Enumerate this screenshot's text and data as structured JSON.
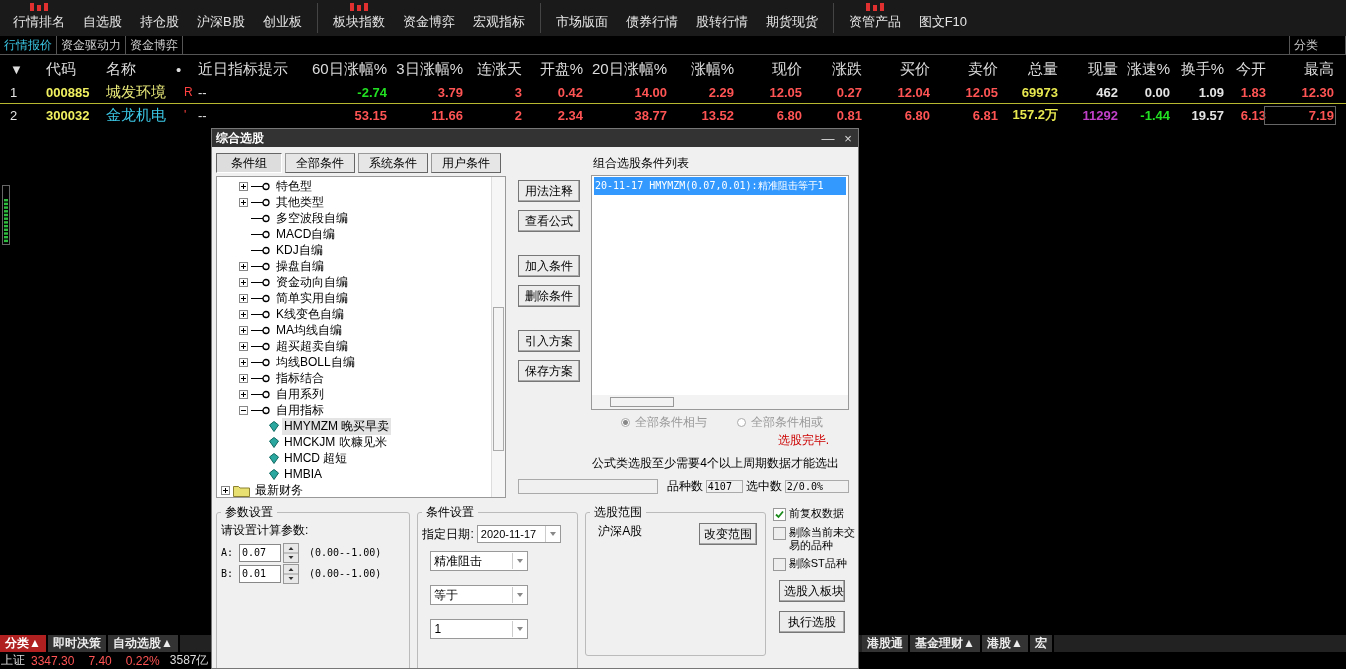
{
  "toolbar": [
    [
      {
        "label": "行情排名",
        "icon": true
      },
      {
        "label": "自选股",
        "icon": false
      },
      {
        "label": "持仓股",
        "icon": false
      },
      {
        "label": "沪深B股",
        "icon": false
      },
      {
        "label": "创业板",
        "icon": false
      }
    ],
    [
      {
        "label": "板块指数",
        "icon": true
      },
      {
        "label": "资金博弈",
        "icon": false
      },
      {
        "label": "宏观指标",
        "icon": false
      }
    ],
    [
      {
        "label": "市场版面",
        "icon": false
      },
      {
        "label": "债券行情",
        "icon": false
      },
      {
        "label": "股转行情",
        "icon": false
      },
      {
        "label": "期货现货",
        "icon": false
      }
    ],
    [
      {
        "label": "资管产品",
        "icon": true
      },
      {
        "label": "图文F10",
        "icon": false
      }
    ]
  ],
  "view_tabs": [
    {
      "label": "行情报价",
      "selected": true
    },
    {
      "label": "资金驱动力",
      "selected": false
    },
    {
      "label": "资金博弈",
      "selected": false
    }
  ],
  "view_tabs_right": "分类",
  "table": {
    "sort_marker": "▼",
    "columns": [
      "代码",
      "名称",
      "•",
      "近日指标提示",
      "60日涨幅%",
      "3日涨幅%",
      "连涨天",
      "开盘%",
      "20日涨幅%",
      "涨幅%",
      "现价",
      "涨跌",
      "买价",
      "卖价",
      "总量",
      "现量",
      "涨速%",
      "换手%",
      "今开",
      "最高"
    ],
    "rows": [
      {
        "index": "1",
        "selected": true,
        "cells": [
          {
            "text": "000885",
            "kind": "code"
          },
          {
            "text": "城发环境",
            "kind": "name",
            "color": "#e8e87a"
          },
          {
            "text": "R",
            "kind": "flag"
          },
          {
            "text": "--",
            "kind": "hint"
          },
          {
            "text": "-2.74",
            "kind": "down"
          },
          {
            "text": "3.79",
            "kind": "up"
          },
          {
            "text": "3",
            "kind": "up"
          },
          {
            "text": "0.42",
            "kind": "up"
          },
          {
            "text": "14.00",
            "kind": "up"
          },
          {
            "text": "2.29",
            "kind": "up"
          },
          {
            "text": "12.05",
            "kind": "up"
          },
          {
            "text": "0.27",
            "kind": "up"
          },
          {
            "text": "12.04",
            "kind": "up"
          },
          {
            "text": "12.05",
            "kind": "up"
          },
          {
            "text": "69973",
            "kind": "volume"
          },
          {
            "text": "462",
            "kind": "flat"
          },
          {
            "text": "0.00",
            "kind": "flat"
          },
          {
            "text": "1.09",
            "kind": "flat"
          },
          {
            "text": "1.83",
            "kind": "up"
          },
          {
            "text": "12.30",
            "kind": "up"
          }
        ]
      },
      {
        "index": "2",
        "selected": false,
        "cells": [
          {
            "text": "300032",
            "kind": "code"
          },
          {
            "text": "金龙机电",
            "kind": "name",
            "color": "#3cc8e6"
          },
          {
            "text": "'",
            "kind": "flag"
          },
          {
            "text": "--",
            "kind": "hint"
          },
          {
            "text": "53.15",
            "kind": "up"
          },
          {
            "text": "11.66",
            "kind": "up"
          },
          {
            "text": "2",
            "kind": "up"
          },
          {
            "text": "2.34",
            "kind": "up"
          },
          {
            "text": "38.77",
            "kind": "up"
          },
          {
            "text": "13.52",
            "kind": "up"
          },
          {
            "text": "6.80",
            "kind": "up"
          },
          {
            "text": "0.81",
            "kind": "up"
          },
          {
            "text": "6.80",
            "kind": "up"
          },
          {
            "text": "6.81",
            "kind": "up"
          },
          {
            "text": "157.2万",
            "kind": "volume"
          },
          {
            "text": "11292",
            "kind": "volume_alt"
          },
          {
            "text": "-1.44",
            "kind": "down"
          },
          {
            "text": "19.57",
            "kind": "flat"
          },
          {
            "text": "6.13",
            "kind": "up"
          },
          {
            "text": "7.19",
            "kind": "up",
            "focus": true
          }
        ]
      }
    ]
  },
  "dialog": {
    "title": "综合选股",
    "minimize": "—",
    "close": "×",
    "tabs": [
      {
        "label": "条件组",
        "selected": true
      },
      {
        "label": "全部条件",
        "selected": false
      },
      {
        "label": "系统条件",
        "selected": false
      },
      {
        "label": "用户条件",
        "selected": false
      }
    ],
    "tree": {
      "continued_children": [
        {
          "label": "特色型",
          "kind": "condition",
          "expanded": false
        },
        {
          "label": "其他类型",
          "kind": "condition",
          "expanded": false
        },
        {
          "label": "多空波段自编",
          "kind": "condition"
        },
        {
          "label": "MACD自编",
          "kind": "condition"
        },
        {
          "label": "KDJ自编",
          "kind": "condition"
        },
        {
          "label": "操盘自编",
          "kind": "condition",
          "expanded": false
        },
        {
          "label": "资金动向自编",
          "kind": "condition",
          "expanded": false
        },
        {
          "label": "简单实用自编",
          "kind": "condition",
          "expanded": false
        },
        {
          "label": "K线变色自编",
          "kind": "condition",
          "expanded": false
        },
        {
          "label": "MA均线自编",
          "kind": "condition",
          "expanded": false
        },
        {
          "label": "超买超卖自编",
          "kind": "condition",
          "expanded": false
        },
        {
          "label": "均线BOLL自编",
          "kind": "condition",
          "expanded": false
        },
        {
          "label": "指标结合",
          "kind": "condition",
          "expanded": false
        },
        {
          "label": "自用系列",
          "kind": "condition",
          "expanded": false
        },
        {
          "label": "自用指标",
          "kind": "condition",
          "expanded": true,
          "children": [
            {
              "label": "HMYMZM 晚买早卖",
              "kind": "formula",
              "selected": true
            },
            {
              "label": "HMCKJM 吹糠见米",
              "kind": "formula",
              "selected": false
            },
            {
              "label": "HMCD 超短",
              "kind": "formula",
              "selected": false
            },
            {
              "label": "HMBIA",
              "kind": "formula",
              "selected": false
            }
          ]
        }
      ],
      "items": [
        {
          "label": "最新财务",
          "kind": "folder",
          "expanded": false
        }
      ]
    },
    "actions": [
      "用法注释",
      "查看公式",
      "加入条件",
      "删除条件",
      "引入方案",
      "保存方案"
    ],
    "list_title": "组合选股条件列表",
    "conditions": [
      {
        "text": "20-11-17 HMYMZM(0.07,0.01):精准阻击等于1",
        "selected": true
      }
    ],
    "logic": [
      {
        "label": "全部条件相与",
        "selected": true
      },
      {
        "label": "全部条件相或",
        "selected": false
      }
    ],
    "status": "选股完毕.",
    "note": "公式类选股至少需要4个以上周期数据才能选出",
    "progress": {
      "level": 0
    },
    "count_label": "品种数",
    "count": "4107",
    "picked_label": "选中数",
    "picked": "2/0.0%",
    "params": {
      "title": "参数设置",
      "prompt": "请设置计算参数:",
      "items": [
        {
          "name": "A:",
          "value": "0.07",
          "range": "(0.00--1.00)"
        },
        {
          "name": "B:",
          "value": "0.01",
          "range": "(0.00--1.00)"
        }
      ]
    },
    "condition_setup": {
      "title": "条件设置",
      "date_label": "指定日期:",
      "date": "2020-11-17",
      "selects": [
        "精准阻击",
        "等于",
        "1"
      ]
    },
    "scope": {
      "title": "选股范围",
      "value": "沪深A股",
      "button": "改变范围"
    },
    "options": [
      {
        "label": "前复权数据",
        "checked": true
      },
      {
        "label": "剔除当前未交易的品种",
        "checked": false
      },
      {
        "label": "剔除ST品种",
        "checked": false
      }
    ],
    "buttons": [
      "选股入板块",
      "执行选股"
    ]
  },
  "bottom_tabs_left": [
    {
      "label": "分类▲",
      "selected": true
    },
    {
      "label": "即时决策",
      "selected": false
    },
    {
      "label": "自动选股▲",
      "selected": false
    }
  ],
  "bottom_tabs_right": [
    {
      "label": "港股通",
      "selected": false
    },
    {
      "label": "基金理财▲",
      "selected": false
    },
    {
      "label": "港股▲",
      "selected": false
    },
    {
      "label": "宏",
      "selected": false
    }
  ],
  "status_bar": {
    "index": "上证",
    "value": "3347.30",
    "change": "7.40",
    "percent": "0.22%",
    "amount": "3587亿"
  }
}
